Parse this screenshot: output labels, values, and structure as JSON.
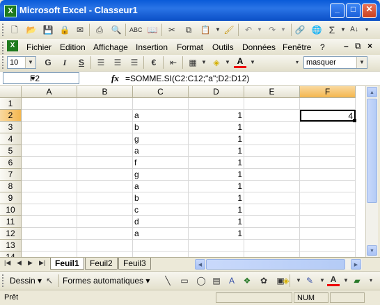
{
  "window": {
    "title": "Microsoft Excel - Classeur1",
    "app_icon": "X"
  },
  "standard_toolbar": {
    "sum_symbol": "Σ"
  },
  "menu": {
    "items": [
      "Fichier",
      "Edition",
      "Affichage",
      "Insertion",
      "Format",
      "Outils",
      "Données",
      "Fenêtre",
      "?"
    ]
  },
  "format_toolbar": {
    "font_size": "10",
    "bold": "G",
    "italic": "I",
    "underline": "S",
    "currency_symbol": "€",
    "font_color_letter": "A",
    "style_combo": "masquer"
  },
  "formula_bar": {
    "cell_ref": "F2",
    "fx": "fx",
    "formula": "=SOMME.SI(C2:C12;\"a\";D2:D12)"
  },
  "columns": [
    "A",
    "B",
    "C",
    "D",
    "E",
    "F"
  ],
  "rows": [
    "1",
    "2",
    "3",
    "4",
    "5",
    "6",
    "7",
    "8",
    "9",
    "10",
    "11",
    "12",
    "13",
    "14"
  ],
  "active_cell": {
    "col": "F",
    "row": "2"
  },
  "cells": {
    "C": [
      "",
      "a",
      "b",
      "g",
      "a",
      "f",
      "g",
      "a",
      "b",
      "c",
      "d",
      "a",
      "",
      ""
    ],
    "D": [
      "",
      "1",
      "1",
      "1",
      "1",
      "1",
      "1",
      "1",
      "1",
      "1",
      "1",
      "1",
      "",
      ""
    ],
    "F": [
      "",
      "4",
      "",
      "",
      "",
      "",
      "",
      "",
      "",
      "",
      "",
      "",
      "",
      ""
    ]
  },
  "sheet_tabs": [
    "Feuil1",
    "Feuil2",
    "Feuil3"
  ],
  "active_sheet": "Feuil1",
  "drawing_toolbar": {
    "draw_label": "Dessin",
    "autoshapes_label": "Formes automatiques",
    "font_color_letter": "A"
  },
  "status_bar": {
    "ready": "Prêt",
    "num": "NUM"
  },
  "colors": {
    "title_blue": "#0a5bd8",
    "close_red": "#c9401e",
    "selected_header": "#f4b64e",
    "chrome": "#ece9d8"
  }
}
